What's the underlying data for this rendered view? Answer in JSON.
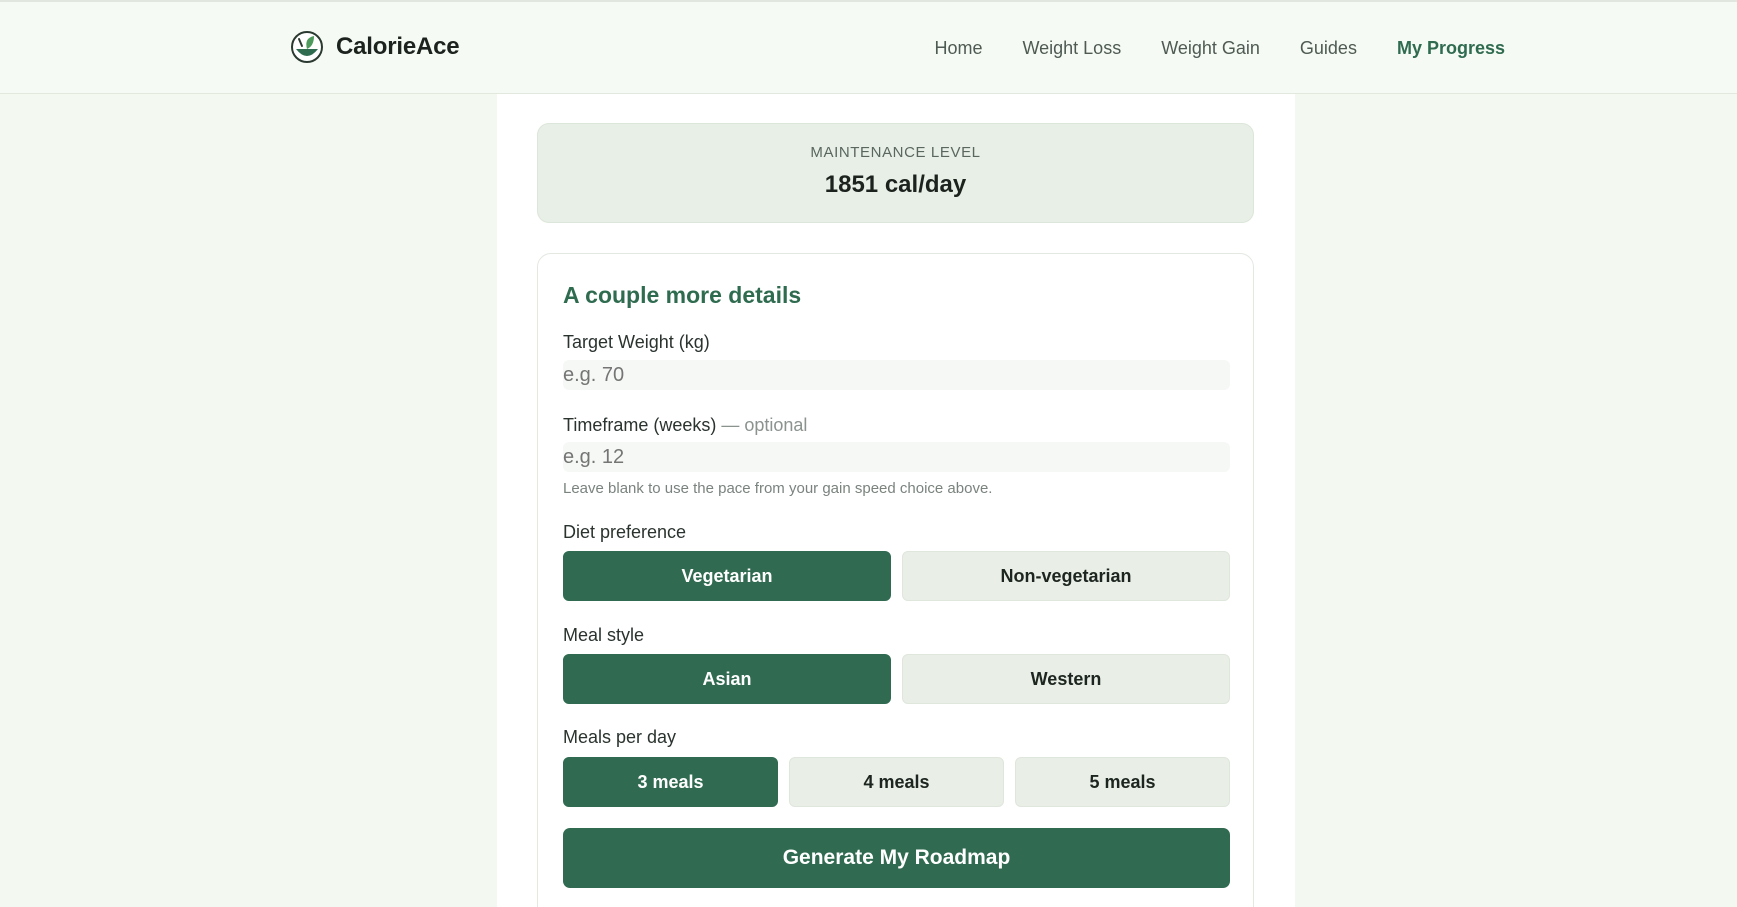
{
  "brand": {
    "name": "CalorieAce",
    "logo_icon": "leaf-bowl-icon"
  },
  "nav": {
    "items": [
      {
        "label": "Home",
        "active": false
      },
      {
        "label": "Weight Loss",
        "active": false
      },
      {
        "label": "Weight Gain",
        "active": false
      },
      {
        "label": "Guides",
        "active": false
      },
      {
        "label": "My Progress",
        "active": true
      }
    ]
  },
  "maintenance": {
    "label": "MAINTENANCE LEVEL",
    "value": "1851 cal/day"
  },
  "details": {
    "title": "A couple more details",
    "target_weight": {
      "label": "Target Weight (kg)",
      "placeholder": "e.g. 70",
      "value": ""
    },
    "timeframe": {
      "label": "Timeframe (weeks)",
      "optional": " — optional",
      "placeholder": "e.g. 12",
      "value": "",
      "help": "Leave blank to use the pace from your gain speed choice above."
    },
    "diet": {
      "label": "Diet preference",
      "options": [
        "Vegetarian",
        "Non-vegetarian"
      ],
      "selected": "Vegetarian"
    },
    "meal_style": {
      "label": "Meal style",
      "options": [
        "Asian",
        "Western"
      ],
      "selected": "Asian"
    },
    "meals_per_day": {
      "label": "Meals per day",
      "options": [
        "3 meals",
        "4 meals",
        "5 meals"
      ],
      "selected": "3 meals"
    },
    "submit_label": "Generate My Roadmap"
  },
  "colors": {
    "accent": "#306b51",
    "page_bg": "#f3f8f1",
    "card_tint": "#e8efe6"
  }
}
